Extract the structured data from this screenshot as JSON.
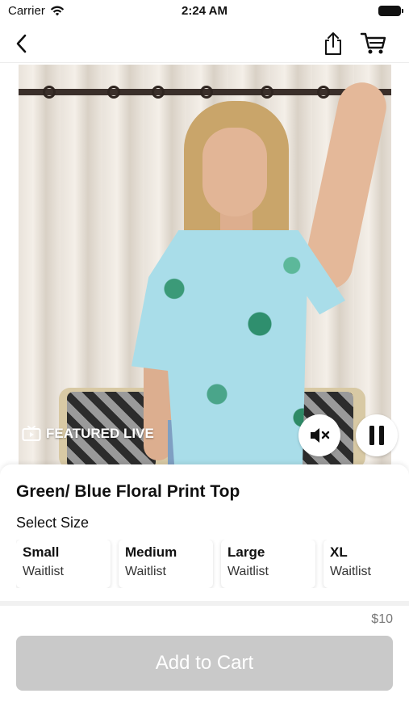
{
  "status_bar": {
    "carrier": "Carrier",
    "time": "2:24 AM"
  },
  "nav": {
    "back_icon": "chevron-left-icon",
    "share_icon": "share-icon",
    "cart_icon": "cart-icon"
  },
  "video": {
    "badge_label": "FEATURED LIVE",
    "badge_icon": "tv-icon",
    "mute_icon": "speaker-muted-icon",
    "pause_icon": "pause-icon"
  },
  "product": {
    "title": "Green/ Blue Floral Print Top",
    "price": "$10"
  },
  "size_section": {
    "label": "Select Size",
    "options": [
      {
        "name": "Small",
        "status": "Waitlist"
      },
      {
        "name": "Medium",
        "status": "Waitlist"
      },
      {
        "name": "Large",
        "status": "Waitlist"
      },
      {
        "name": "XL",
        "status": "Waitlist"
      }
    ]
  },
  "cta": {
    "add_to_cart_label": "Add to Cart",
    "disabled_color": "#c9c9c9"
  }
}
